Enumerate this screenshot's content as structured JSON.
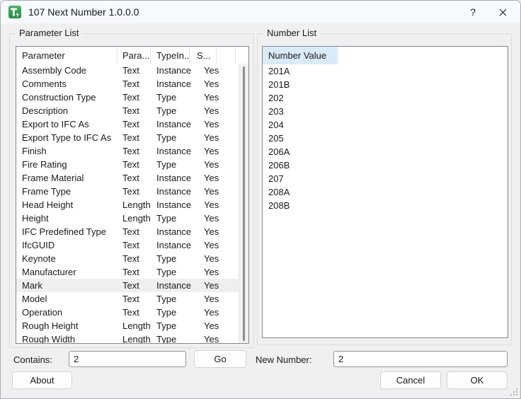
{
  "window": {
    "title": "107 Next Number 1.0.0.0",
    "help_label": "?"
  },
  "parameter_list": {
    "group_label": "Parameter List",
    "columns": [
      "Parameter",
      "Para...",
      "TypeIn...",
      "S..."
    ],
    "selected_index": 16,
    "rows": [
      {
        "name": "Assembly Code",
        "param_type": "Text",
        "type_instance": "Instance",
        "shared": "Yes"
      },
      {
        "name": "Comments",
        "param_type": "Text",
        "type_instance": "Instance",
        "shared": "Yes"
      },
      {
        "name": "Construction Type",
        "param_type": "Text",
        "type_instance": "Type",
        "shared": "Yes"
      },
      {
        "name": "Description",
        "param_type": "Text",
        "type_instance": "Type",
        "shared": "Yes"
      },
      {
        "name": "Export to IFC As",
        "param_type": "Text",
        "type_instance": "Instance",
        "shared": "Yes"
      },
      {
        "name": "Export Type to IFC As",
        "param_type": "Text",
        "type_instance": "Type",
        "shared": "Yes"
      },
      {
        "name": "Finish",
        "param_type": "Text",
        "type_instance": "Instance",
        "shared": "Yes"
      },
      {
        "name": "Fire Rating",
        "param_type": "Text",
        "type_instance": "Type",
        "shared": "Yes"
      },
      {
        "name": "Frame Material",
        "param_type": "Text",
        "type_instance": "Instance",
        "shared": "Yes"
      },
      {
        "name": "Frame Type",
        "param_type": "Text",
        "type_instance": "Instance",
        "shared": "Yes"
      },
      {
        "name": "Head Height",
        "param_type": "Length",
        "type_instance": "Instance",
        "shared": "Yes"
      },
      {
        "name": "Height",
        "param_type": "Length",
        "type_instance": "Type",
        "shared": "Yes"
      },
      {
        "name": "IFC Predefined Type",
        "param_type": "Text",
        "type_instance": "Instance",
        "shared": "Yes"
      },
      {
        "name": "IfcGUID",
        "param_type": "Text",
        "type_instance": "Instance",
        "shared": "Yes"
      },
      {
        "name": "Keynote",
        "param_type": "Text",
        "type_instance": "Type",
        "shared": "Yes"
      },
      {
        "name": "Manufacturer",
        "param_type": "Text",
        "type_instance": "Type",
        "shared": "Yes"
      },
      {
        "name": "Mark",
        "param_type": "Text",
        "type_instance": "Instance",
        "shared": "Yes"
      },
      {
        "name": "Model",
        "param_type": "Text",
        "type_instance": "Type",
        "shared": "Yes"
      },
      {
        "name": "Operation",
        "param_type": "Text",
        "type_instance": "Type",
        "shared": "Yes"
      },
      {
        "name": "Rough Height",
        "param_type": "Length",
        "type_instance": "Type",
        "shared": "Yes"
      },
      {
        "name": "Rough Width",
        "param_type": "Length",
        "type_instance": "Type",
        "shared": "Yes"
      }
    ]
  },
  "parameter_row_fix": {
    "0": "Type",
    "1": "Instance"
  },
  "number_list": {
    "group_label": "Number List",
    "column_header": "Number Value",
    "values": [
      "201A",
      "201B",
      "202",
      "203",
      "204",
      "205",
      "206A",
      "206B",
      "207",
      "208A",
      "208B"
    ]
  },
  "footer": {
    "contains_label": "Contains:",
    "contains_value": "2",
    "go_label": "Go",
    "new_number_label": "New Number:",
    "new_number_value": "2"
  },
  "buttons": {
    "about": "About",
    "cancel": "Cancel",
    "ok": "OK"
  },
  "colors": {
    "titlebar_bg": "#f6fafd",
    "dialog_bg": "#f0f0f0",
    "list_border": "#828790",
    "selected_row_bg": "#efefef",
    "number_header_bg": "#d9eaf9",
    "icon_green_light": "#43ad5c",
    "icon_green_dark": "#1f8f45",
    "scrollbar_thumb": "#8f8f8f"
  }
}
